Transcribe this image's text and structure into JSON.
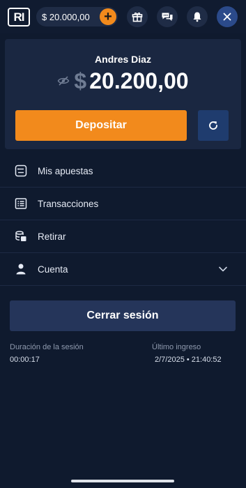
{
  "header": {
    "logo_text": "RI",
    "balance": "$ 20.000,00",
    "plus_symbol": "+",
    "icons": [
      "gift-icon",
      "chat-icon",
      "bell-icon",
      "close-icon"
    ]
  },
  "account": {
    "user_name": "Andres Diaz",
    "currency_symbol": "$",
    "balance_amount": "20.200,00",
    "deposit_label": "Depositar"
  },
  "menu": [
    {
      "label": "Mis apuestas",
      "icon": "bets-icon"
    },
    {
      "label": "Transacciones",
      "icon": "transactions-icon"
    },
    {
      "label": "Retirar",
      "icon": "withdraw-icon"
    },
    {
      "label": "Cuenta",
      "icon": "user-icon"
    }
  ],
  "logout_label": "Cerrar sesión",
  "session": {
    "duration_label": "Duración de la sesión",
    "duration_value": "00:00:17",
    "last_login_label": "Último ingreso",
    "last_login_value": "2/7/2025 • 21:40:52"
  },
  "colors": {
    "background": "#0f1a2e",
    "accent": "#f28a1c",
    "card": "#1a2741",
    "close_button": "#2b4a8a"
  }
}
